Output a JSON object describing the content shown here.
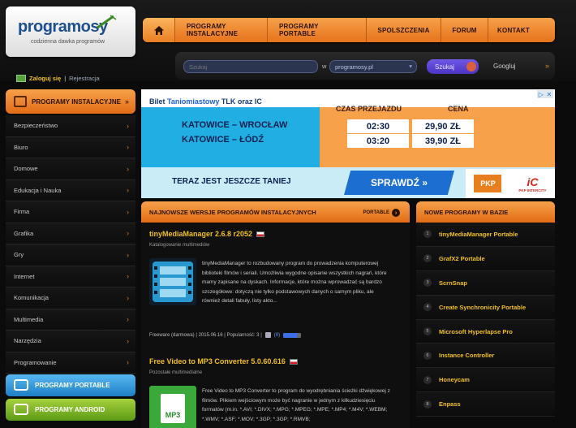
{
  "logo": {
    "name": "programosy",
    "tagline": "codzienna dawka programów"
  },
  "login": {
    "login_label": "Zaloguj się",
    "separator": "|",
    "register_label": "Rejestracja"
  },
  "nav": {
    "home_icon": "home-icon",
    "items": [
      "PROGRAMY INSTALACYJNE",
      "PROGRAMY PORTABLE",
      "SPOLSZCZENIA",
      "FORUM",
      "KONTAKT"
    ]
  },
  "search": {
    "placeholder": "Szukaj",
    "in_label": "w",
    "site_value": "programosy.pl",
    "button_label": "Szukaj",
    "googluj_label": "Googluj",
    "googluj_arrow": "»"
  },
  "sidebar": {
    "header": "PROGRAMY INSTALACYJNE",
    "header_chevron": "»",
    "items": [
      "Bezpieczeństwo",
      "Biuro",
      "Domowe",
      "Edukacja i Nauka",
      "Firma",
      "Grafika",
      "Gry",
      "Internet",
      "Komunikacja",
      "Multimedia",
      "Narzędzia",
      "Programowanie"
    ],
    "portable_button": "PROGRAMY PORTABLE",
    "android_button": "PROGRAMY ANDROID"
  },
  "banner": {
    "title_prefix": "Bilet",
    "title_brand": "Taniomiastowy",
    "title_suffix": "TLK oraz IC",
    "col_time": "CZAS PRZEJAZDU",
    "col_price": "CENA",
    "routes": [
      {
        "route": "KATOWICE – WROCŁAW",
        "time": "02:30",
        "price": "29,90 ZŁ"
      },
      {
        "route": "KATOWICE – ŁÓDŹ",
        "time": "03:20",
        "price": "39,90 ZŁ"
      }
    ],
    "promo": "TERAZ JEST JESZCZE TANIEJ",
    "cta": "SPRAWDŹ »",
    "logo_pkp": "PKP",
    "logo_ic": "iC",
    "logo_ic_sub": "PKP INTERCITY"
  },
  "main": {
    "header": "NAJNOWSZE WERSJE PROGRAMÓW INSTALACYJNYCH",
    "portable_link": "PORTABLE",
    "portable_arrow": "›",
    "entries": [
      {
        "name": "tinyMediaManager 2.6.8 r2052",
        "category": "Katalogowanie multimediów",
        "description": "tinyMediaManager to rozbudowany program do prowadzenia komputerowej biblioteki filmów i seriali. Umożliwia wygodne opisanie wszystkich nagrań, które mamy zapisane na dyskach. Informacje, które można wprowadzać są bardzo szczegółowe: dotyczą nie tylko podstawowych danych o samym pliku, ale również detali fabuły, listy akto...",
        "meta": "Freeware (darmowa) | 2015.06.16 | Popularność: 3 |",
        "comments": "(0)"
      },
      {
        "name": "Free Video to MP3 Converter 5.0.60.616",
        "category": "Pozostałe multimedialne",
        "thumb_label": "MP3",
        "description": "Free Video to MP3 Converter to program do wyodrębniania ścieżki dźwiękowej z filmów. Plikiem wejściowym może być nagranie w jednym z kilkudziesięciu formatów (m.in. *.AVI; *.DIVX; *.MPG; *.MPEG; *.MPE; *.MP4; *.M4V; *.WEBM; *.WMV; *.ASF; *.MOV; *.3GP; *.3GP; *.RMVB;"
      }
    ]
  },
  "right": {
    "header": "NOWE PROGRAMY W BAZIE",
    "items": [
      {
        "num": "1",
        "name": "tinyMediaManager Portable"
      },
      {
        "num": "2",
        "name": "GrafX2 Portable"
      },
      {
        "num": "3",
        "name": "ScrnSnap"
      },
      {
        "num": "4",
        "name": "Create Synchronicity Portable"
      },
      {
        "num": "5",
        "name": "Microsoft Hyperlapse Pro"
      },
      {
        "num": "6",
        "name": "Instance Controller"
      },
      {
        "num": "7",
        "name": "Honeycam"
      },
      {
        "num": "8",
        "name": "Enpass"
      }
    ]
  }
}
